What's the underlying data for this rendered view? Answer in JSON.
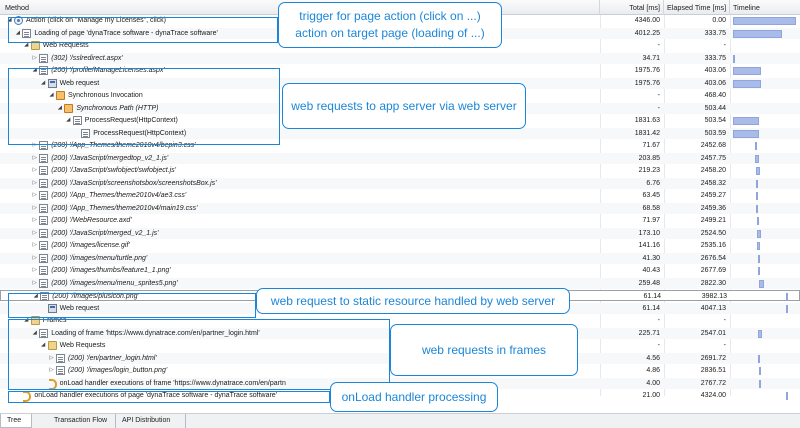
{
  "header": {
    "method": "Method",
    "total": "Total [ms]",
    "elapsed": "Elapsed Time [ms]",
    "timeline": "Timeline"
  },
  "rows": [
    {
      "label": "Action (click on \"Manage my Licenses\", click)",
      "total": "4346.00",
      "elapsed": "0.00",
      "icon": "action-icon"
    },
    {
      "label": "Loading of page 'dynaTrace software - dynaTrace software'",
      "total": "4012.25",
      "elapsed": "333.75",
      "icon": "page-icon"
    },
    {
      "label": "Web Requests",
      "total": "-",
      "elapsed": "-",
      "icon": "folder-icon"
    },
    {
      "label": "(302) '/sslredirect.aspx'",
      "total": "34.71",
      "elapsed": "333.75",
      "icon": "page-icon"
    },
    {
      "label": "(200) '/profile/ManageLicenses.aspx'",
      "total": "1975.76",
      "elapsed": "403.06",
      "icon": "page-icon"
    },
    {
      "label": "Web request",
      "total": "1975.76",
      "elapsed": "403.06",
      "icon": "server-icon"
    },
    {
      "label": "Synchronous Invocation",
      "total": "-",
      "elapsed": "468.40",
      "icon": "sync-icon"
    },
    {
      "label": "Synchronous Path (HTTP)",
      "total": "-",
      "elapsed": "503.44",
      "icon": "sync-icon"
    },
    {
      "label": "ProcessRequest(HttpContext)",
      "total": "1831.63",
      "elapsed": "503.54",
      "icon": "method-icon"
    },
    {
      "label": "ProcessRequest(HttpContext)",
      "total": "1831.42",
      "elapsed": "503.59",
      "icon": "method-icon"
    },
    {
      "label": "(200) '/App_Themes/theme2010v4/bepin3.css'",
      "total": "71.67",
      "elapsed": "2452.68",
      "icon": "page-icon"
    },
    {
      "label": "(200) '/JavaScript/mergedtop_v2_1.js'",
      "total": "203.85",
      "elapsed": "2457.75",
      "icon": "page-icon"
    },
    {
      "label": "(200) '/JavaScript/swfobject/swfobject.js'",
      "total": "219.23",
      "elapsed": "2458.20",
      "icon": "page-icon"
    },
    {
      "label": "(200) '/JavaScript/screenshotsbox/screenshotsBox.js'",
      "total": "6.76",
      "elapsed": "2458.32",
      "icon": "page-icon"
    },
    {
      "label": "(200) '/App_Themes/theme2010v4/ae3.css'",
      "total": "63.45",
      "elapsed": "2459.27",
      "icon": "page-icon"
    },
    {
      "label": "(200) '/App_Themes/theme2010v4/main19.css'",
      "total": "68.58",
      "elapsed": "2459.36",
      "icon": "page-icon"
    },
    {
      "label": "(200) '/WebResource.axd'",
      "total": "71.97",
      "elapsed": "2499.21",
      "icon": "page-icon"
    },
    {
      "label": "(200) '/JavaScript/merged_v2_1.js'",
      "total": "173.10",
      "elapsed": "2524.50",
      "icon": "page-icon"
    },
    {
      "label": "(200) '/images/license.gif'",
      "total": "141.16",
      "elapsed": "2535.16",
      "icon": "page-icon"
    },
    {
      "label": "(200) '/images/menu/turtle.png'",
      "total": "41.30",
      "elapsed": "2676.54",
      "icon": "page-icon"
    },
    {
      "label": "(200) '/images/thumbs/feature1_1.png'",
      "total": "40.43",
      "elapsed": "2677.69",
      "icon": "page-icon"
    },
    {
      "label": "(200) '/images/menu/menu_sprites5.png'",
      "total": "259.48",
      "elapsed": "2822.30",
      "icon": "page-icon"
    },
    {
      "label": "(200) '/images/plusicon.png'",
      "total": "61.14",
      "elapsed": "3982.13",
      "icon": "page-icon"
    },
    {
      "label": "Web request",
      "total": "61.14",
      "elapsed": "4047.13",
      "icon": "server-icon"
    },
    {
      "label": "Frames",
      "total": "-",
      "elapsed": "-",
      "icon": "folder-icon"
    },
    {
      "label": "Loading of frame 'https://www.dynatrace.com/en/partner_login.html'",
      "total": "225.71",
      "elapsed": "2547.01",
      "icon": "page-icon"
    },
    {
      "label": "Web Requests",
      "total": "-",
      "elapsed": "-",
      "icon": "folder-icon"
    },
    {
      "label": "(200) '/en/partner_login.html'",
      "total": "4.56",
      "elapsed": "2691.72",
      "icon": "page-icon"
    },
    {
      "label": "(200) '/images/login_button.png'",
      "total": "4.86",
      "elapsed": "2836.51",
      "icon": "page-icon"
    },
    {
      "label": "onLoad handler executions of frame 'https://www.dynatrace.com/en/partn",
      "total": "4.00",
      "elapsed": "2767.72",
      "icon": "onload-icon"
    },
    {
      "label": "onLoad handler executions of page 'dynaTrace software - dynaTrace software'",
      "total": "21.00",
      "elapsed": "4324.00",
      "icon": "onload-icon"
    }
  ],
  "callouts": {
    "trigger_line1": "trigger for page action (click on ...)",
    "trigger_line2": "action on target page (loading of ...)",
    "appserver": "web requests to app server via web server",
    "static": "web request to static resource handled by web server",
    "frames": "web requests in frames",
    "onload": "onLoad handler processing"
  },
  "tabs": {
    "tree": "Tree",
    "transaction_flow": "Transaction Flow",
    "api_distribution": "API Distribution"
  },
  "colors": {
    "accent": "#1b86d8",
    "timeline_bar": "#a9bbe8"
  }
}
